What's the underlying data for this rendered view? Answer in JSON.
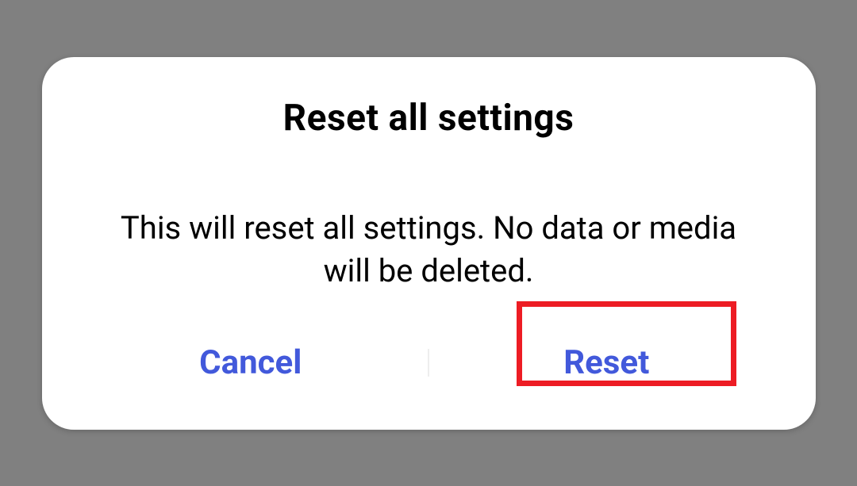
{
  "dialog": {
    "title": "Reset all settings",
    "message": "This will reset all settings. No data or media will be deleted.",
    "cancel_label": "Cancel",
    "confirm_label": "Reset"
  }
}
